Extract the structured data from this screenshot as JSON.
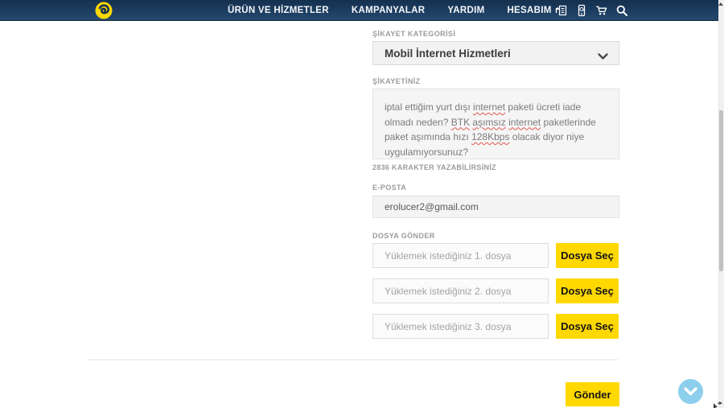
{
  "navbar": {
    "brand_name": "turkcell-logo",
    "items": [
      {
        "label": "ÜRÜN VE HİZMETLER"
      },
      {
        "label": "KAMPANYALAR"
      },
      {
        "label": "YARDIM"
      },
      {
        "label": "HESABIM"
      }
    ],
    "icons": [
      "document-upload-icon",
      "mobile-device-icon",
      "cart-icon",
      "search-icon"
    ]
  },
  "form": {
    "category": {
      "label": "ŞİKAYET KATEGORİSİ",
      "selected": "Mobil İnternet Hizmetleri"
    },
    "complaint": {
      "label": "ŞİKAYETİNİZ",
      "text": "iptal ettiğim yurt dışı internet paketi ücreti iade olmadı neden? BTK aşımsız internet paketlerinde paket aşımında hızı 128Kbps olacak diyor niye uygulamıyorsunuz?",
      "misspelled": [
        "internet",
        "BTK",
        "aşımsız",
        "128Kbps"
      ],
      "char_info": "2836 KARAKTER YAZABİLİRSİNİZ"
    },
    "email": {
      "label": "E-POSTA",
      "value": "erolucer2@gmail.com"
    },
    "files": {
      "label": "DOSYA GÖNDER",
      "rows": [
        {
          "placeholder": "Yüklemek istediğiniz 1. dosya",
          "button": "Dosya Seç"
        },
        {
          "placeholder": "Yüklemek istediğiniz 2. dosya",
          "button": "Dosya Seç"
        },
        {
          "placeholder": "Yüklemek istediğiniz 3. dosya",
          "button": "Dosya Seç"
        }
      ]
    },
    "submit_label": "Gönder"
  },
  "colors": {
    "accent_yellow": "#ffd800",
    "navbar_blue": "#1d3d60",
    "scroll_fab_blue": "#8ccfec"
  }
}
